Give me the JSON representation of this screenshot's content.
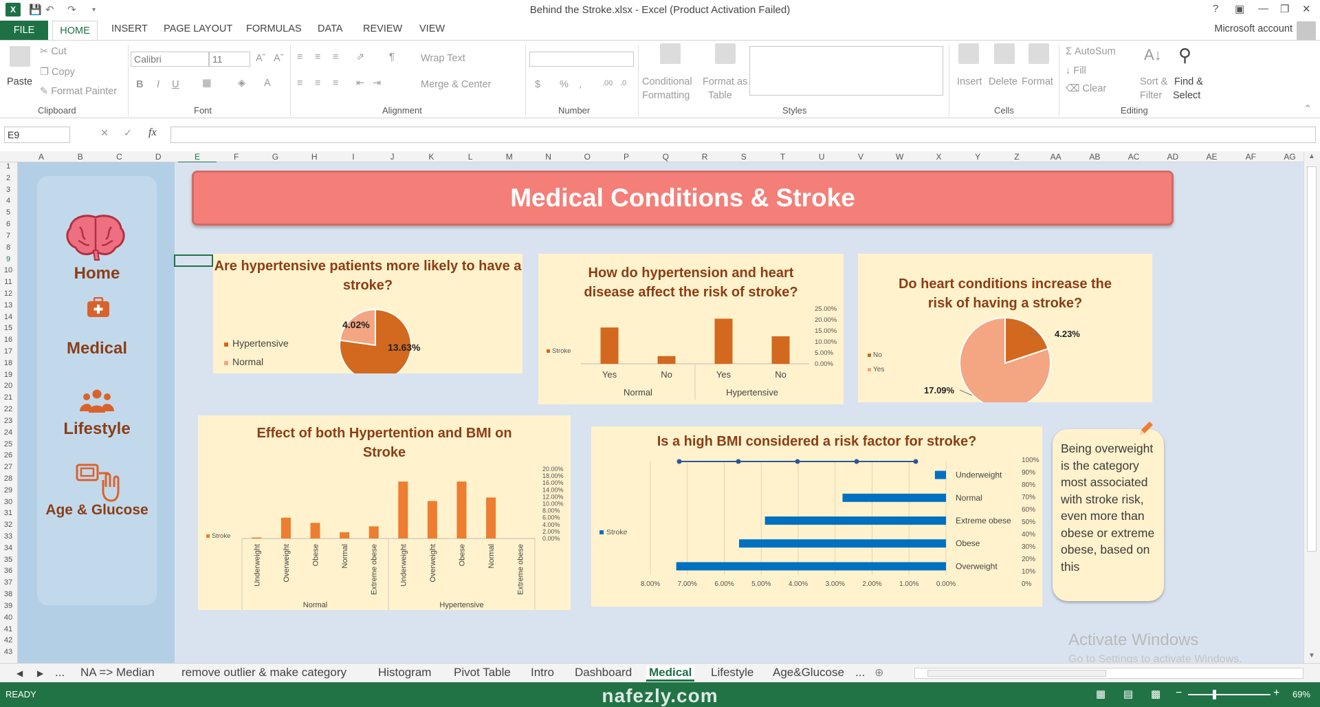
{
  "app": {
    "title": "Behind the Stroke.xlsx - Excel (Product Activation Failed)",
    "icon_label": "X",
    "account": "Microsoft account"
  },
  "ribbon_tabs": [
    "FILE",
    "HOME",
    "INSERT",
    "PAGE LAYOUT",
    "FORMULAS",
    "DATA",
    "REVIEW",
    "VIEW"
  ],
  "ribbon": {
    "clipboard": {
      "paste": "Paste",
      "cut": "Cut",
      "copy": "Copy",
      "format_painter": "Format Painter",
      "label": "Clipboard"
    },
    "font": {
      "name": "Calibri",
      "size": "11",
      "bold": "B",
      "italic": "I",
      "underline": "U",
      "label": "Font"
    },
    "alignment": {
      "wrap": "Wrap Text",
      "merge": "Merge & Center",
      "label": "Alignment"
    },
    "number": {
      "currency": "$",
      "percent": "%",
      "comma": ",",
      "label": "Number"
    },
    "styles": {
      "cond1": "Conditional",
      "cond2": "Formatting",
      "fmt1": "Format as",
      "fmt2": "Table",
      "label": "Styles"
    },
    "cells": {
      "insert": "Insert",
      "delete": "Delete",
      "format": "Format",
      "label": "Cells"
    },
    "editing": {
      "autosum": "AutoSum",
      "fill": "Fill",
      "clear": "Clear",
      "sort1": "Sort &",
      "sort2": "Filter",
      "find1": "Find &",
      "find2": "Select",
      "label": "Editing"
    }
  },
  "formula_bar": {
    "namebox": "E9",
    "fx": "fx",
    "value": ""
  },
  "columns": [
    "A",
    "B",
    "C",
    "D",
    "E",
    "F",
    "G",
    "H",
    "I",
    "J",
    "K",
    "L",
    "M",
    "N",
    "O",
    "P",
    "Q",
    "R",
    "S",
    "T",
    "U",
    "V",
    "W",
    "X",
    "Y",
    "Z",
    "AA",
    "AB",
    "AC",
    "AD",
    "AE",
    "AF",
    "AG"
  ],
  "rows": [
    "1",
    "2",
    "3",
    "4",
    "5",
    "6",
    "7",
    "8",
    "9",
    "10",
    "11",
    "12",
    "13",
    "14",
    "15",
    "16",
    "17",
    "18",
    "19",
    "20",
    "21",
    "22",
    "23",
    "24",
    "25",
    "26",
    "27",
    "28",
    "29",
    "30",
    "31",
    "32",
    "33",
    "34",
    "35",
    "36",
    "37",
    "38",
    "39",
    "40",
    "41",
    "42",
    "43"
  ],
  "nav": {
    "home": "Home",
    "medical": "Medical",
    "lifestyle": "Lifestyle",
    "age_glucose": "Age & Glucose"
  },
  "banner": "Medical Conditions & Stroke",
  "note": "Being overweight is the category most associated with stroke risk, even more than obese or extreme obese, based on this",
  "activate": {
    "line1": "Activate Windows",
    "line2": "Go to Settings to activate Windows."
  },
  "sheet_tabs": [
    "NA => Median",
    "remove outlier & make category",
    "Histogram",
    "Pivot Table",
    "Intro",
    "Dashboard",
    "Medical",
    "Lifestyle",
    "Age&Glucose"
  ],
  "status": {
    "ready": "READY",
    "zoom": "69%"
  },
  "watermark": "nafezly.com",
  "colors": {
    "accent": "#1e7145",
    "orange": "#ed7d31",
    "dark_orange": "#d2691e",
    "salmon": "#f4a582",
    "blue": "#0070c0",
    "title": "#8a3e17"
  },
  "chart_data": [
    {
      "type": "pie",
      "title": "Are hypertensive patients more likely to have a stroke?",
      "labels": [
        "Hypertensive",
        "Normal"
      ],
      "values": [
        13.63,
        4.02
      ],
      "value_labels": [
        "13.63%",
        "4.02%"
      ],
      "legend": "left"
    },
    {
      "type": "bar",
      "title": "How do hypertension and heart disease affect the risk of stroke?",
      "categories": [
        "Yes",
        "No",
        "Yes",
        "No"
      ],
      "groups": [
        "Normal",
        "Hypertensive"
      ],
      "series": [
        {
          "name": "Stroke",
          "values": [
            16.5,
            3.5,
            20.5,
            12.5
          ]
        }
      ],
      "yticks": [
        "25.00%",
        "20.00%",
        "15.00%",
        "10.00%",
        "5.00%",
        "0.00%"
      ],
      "ylim": [
        0,
        25
      ],
      "legend": "left"
    },
    {
      "type": "pie",
      "title": "Do heart conditions increase the risk of having a stroke?",
      "labels": [
        "No",
        "Yes"
      ],
      "values": [
        4.23,
        17.09
      ],
      "value_labels": [
        "4.23%",
        "17.09%"
      ],
      "legend": "left"
    },
    {
      "type": "bar",
      "title": "Effect of both Hypertention and BMI on Stroke",
      "categories": [
        "Underweight",
        "Overweight",
        "Obese",
        "Normal",
        "Extreme obese",
        "Underweight",
        "Overweight",
        "Obese",
        "Normal",
        "Extreme obese"
      ],
      "groups": [
        "Normal",
        "Hypertensive"
      ],
      "series": [
        {
          "name": "Stroke",
          "values": [
            0.3,
            6.0,
            4.5,
            1.8,
            3.5,
            16.4,
            10.8,
            16.4,
            11.8,
            0
          ]
        }
      ],
      "yticks": [
        "20.00%",
        "18.00%",
        "16.00%",
        "14.00%",
        "12.00%",
        "10.00%",
        "8.00%",
        "6.00%",
        "4.00%",
        "2.00%",
        "0.00%"
      ],
      "ylim": [
        0,
        20
      ],
      "legend": "left"
    },
    {
      "type": "bar",
      "orientation": "horizontal",
      "title": "Is a high BMI considered a risk factor for stroke?",
      "categories": [
        "Underweight",
        "Normal",
        "Extreme obese",
        "Obese",
        "Overweight"
      ],
      "series": [
        {
          "name": "Stroke",
          "values": [
            0.3,
            2.8,
            4.9,
            5.6,
            7.3
          ]
        }
      ],
      "xticks": [
        "8.00%",
        "7.00%",
        "6.00%",
        "5.00%",
        "4.00%",
        "3.00%",
        "2.00%",
        "1.00%",
        "0.00%"
      ],
      "secondary_ticks": [
        "100%",
        "90%",
        "80%",
        "70%",
        "60%",
        "50%",
        "40%",
        "30%",
        "20%",
        "10%",
        "0%"
      ],
      "xlim": [
        8,
        0
      ],
      "legend": "left"
    }
  ]
}
